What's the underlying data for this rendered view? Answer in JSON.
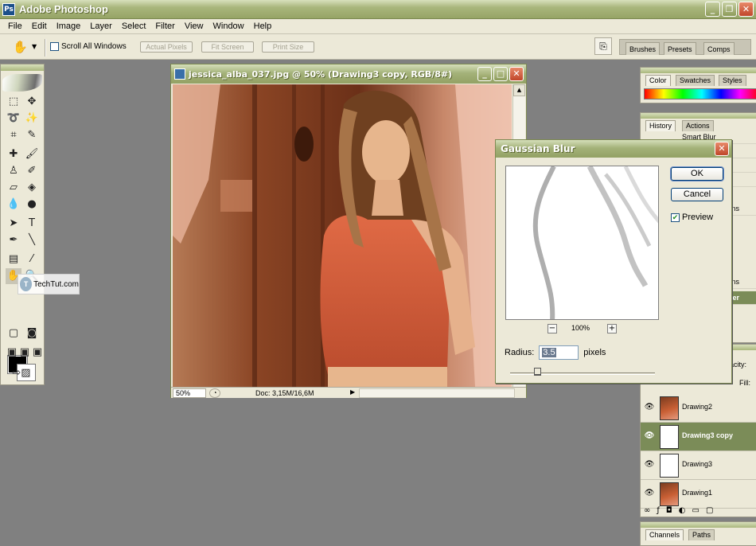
{
  "app": {
    "title": "Adobe Photoshop",
    "icon": "Ps"
  },
  "menu": [
    "File",
    "Edit",
    "Image",
    "Layer",
    "Select",
    "Filter",
    "View",
    "Window",
    "Help"
  ],
  "options_bar": {
    "scroll_all_windows": "Scroll All Windows",
    "actual_pixels": "Actual Pixels",
    "fit_screen": "Fit Screen",
    "print_size": "Print Size",
    "well_tabs": [
      "Brushes",
      "Presets",
      "Comps"
    ]
  },
  "watermark": {
    "logo": "T",
    "text": "TechTut.com"
  },
  "document": {
    "title": "jessica_alba_037.jpg @ 50% (Drawing3 copy, RGB/8#)",
    "zoom": "50%",
    "doc_info": "Doc: 3,15M/16,6M"
  },
  "gaussian_blur": {
    "title": "Gaussian Blur",
    "ok": "OK",
    "cancel": "Cancel",
    "preview_label": "Preview",
    "preview_checked": true,
    "zoom": "100%",
    "radius_label": "Radius:",
    "radius_value": "3.5",
    "radius_unit": "pixels"
  },
  "palettes": {
    "color_tabs": [
      "Color",
      "Swatches",
      "Styles"
    ],
    "history_tabs": [
      "History",
      "Actions"
    ],
    "history_first": "Smart Blur",
    "history_partial": [
      "ns",
      "ns",
      "er"
    ],
    "layers_labels": {
      "opacity": "acity:",
      "fill": "Fill:"
    },
    "layers": [
      {
        "name": "Drawing2",
        "thumb": "photo",
        "selected": false
      },
      {
        "name": "Drawing3 copy",
        "thumb": "sketch",
        "selected": true
      },
      {
        "name": "Drawing3",
        "thumb": "sketch",
        "selected": false
      },
      {
        "name": "Drawing1",
        "thumb": "photo",
        "selected": false
      }
    ],
    "bottom_tabs": [
      "Channels",
      "Paths"
    ]
  }
}
